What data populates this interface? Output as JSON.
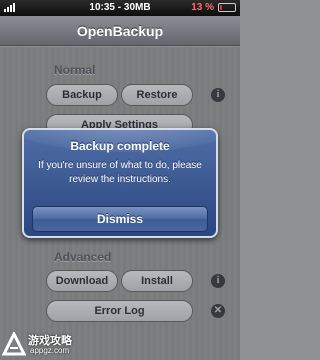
{
  "status_bar": {
    "time": "10:35 - 30MB",
    "battery_percent": "13 %",
    "battery_level": 0.13
  },
  "navbar": {
    "title": "OpenBackup"
  },
  "sections": {
    "normal": {
      "label": "Normal",
      "backup_label": "Backup",
      "restore_label": "Restore",
      "apply_settings_label": "Apply Settings"
    },
    "advanced": {
      "label": "Advanced",
      "download_label": "Download",
      "install_label": "Install",
      "error_log_label": "Error Log"
    }
  },
  "icons": {
    "info": "info-icon",
    "close": "close-icon"
  },
  "alert": {
    "title": "Backup complete",
    "message": "If you're unsure of what to do, please review the instructions.",
    "dismiss_label": "Dismiss"
  },
  "watermark": {
    "text": "游戏攻略",
    "url": "appgz.com"
  },
  "colors": {
    "alert_blue": "#2b4680",
    "battery_red": "#e03030"
  }
}
